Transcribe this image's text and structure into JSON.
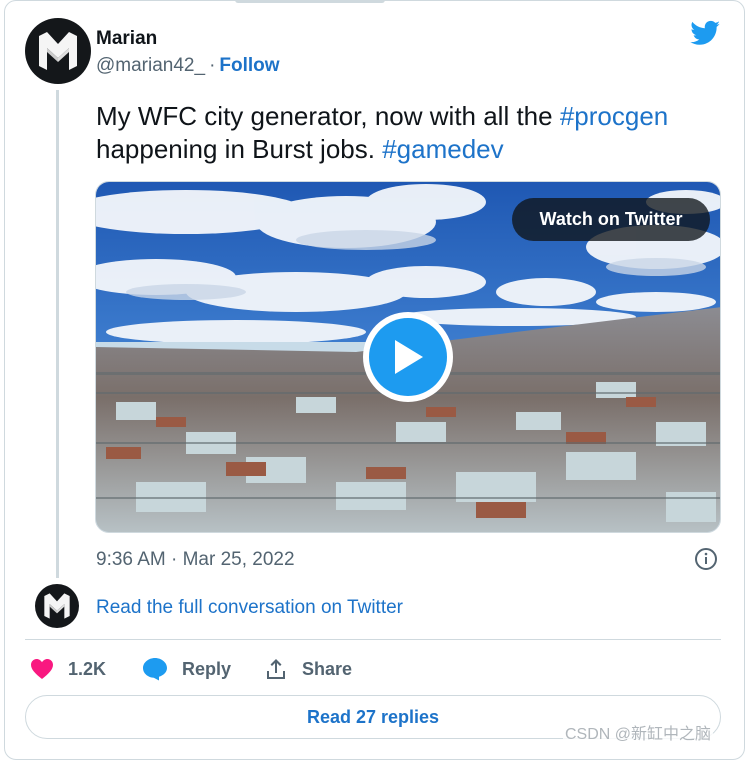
{
  "tweet": {
    "display_name": "Marian",
    "handle": "@marian42_",
    "follow_label": "Follow",
    "text_line1_prefix": "My WFC city generator, now with all the ",
    "hashtag1": "#procgen",
    "text_line2_prefix": "happening in Burst jobs. ",
    "hashtag2": "#gamedev",
    "timestamp": "9:36 AM · Mar 25, 2022"
  },
  "media": {
    "watch_label": "Watch on Twitter",
    "play_icon": "play-icon"
  },
  "conversation": {
    "read_full_label": "Read the full conversation on Twitter"
  },
  "actions": {
    "likes_count": "1.2K",
    "reply_label": "Reply",
    "share_label": "Share",
    "read_replies_label": "Read 27 replies"
  },
  "watermark": "CSDN @新缸中之脑",
  "colors": {
    "link": "#1d73c9",
    "twitter_blue": "#1d9bf0",
    "like_pink": "#f91880",
    "muted": "#536471",
    "border": "#cfd9de"
  }
}
